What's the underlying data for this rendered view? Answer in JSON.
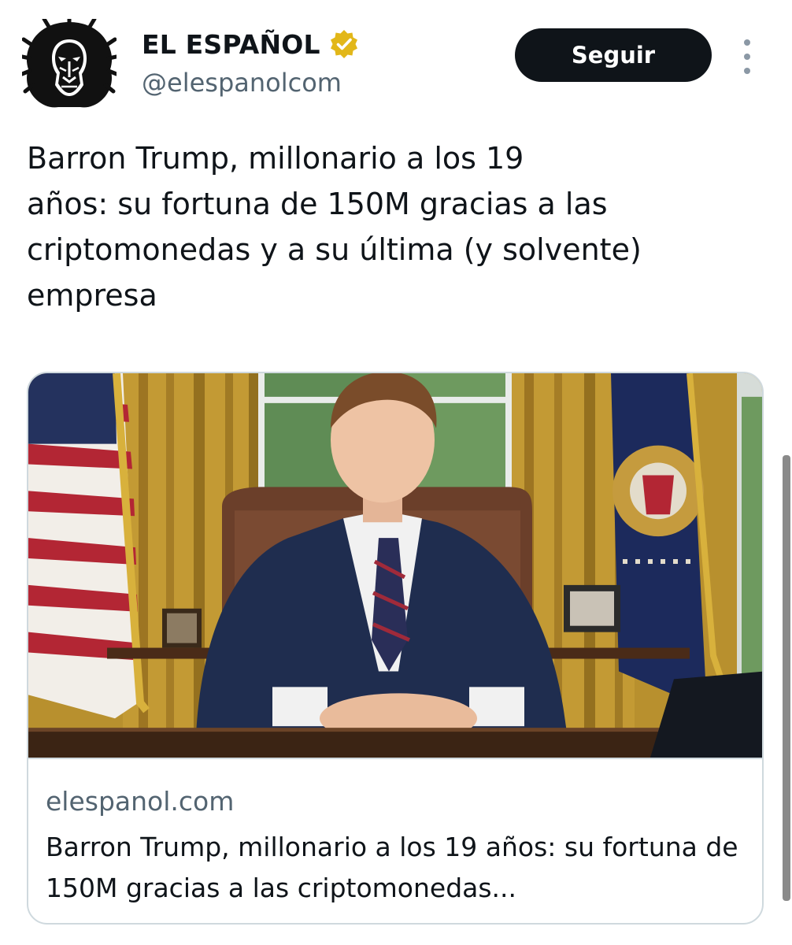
{
  "account": {
    "display_name": "EL ESPAÑOL",
    "handle": "@elespanolcom",
    "avatar_icon": "lion-head-logo",
    "verified_icon": "verified-gold-badge-icon",
    "verified_color": "#e2b719"
  },
  "actions": {
    "follow_label": "Seguir",
    "more_icon": "more-vertical-icon"
  },
  "tweet": {
    "text": "Barron Trump, millonario a los 19\naños: su fortuna de 150M gracias a las\ncriptomonedas y a su última (y solvente)\nempresa"
  },
  "link_card": {
    "domain": "elespanol.com",
    "title": "Barron Trump, millonario a los 19 años: su fortuna de 150M gracias a las criptomonedas..."
  },
  "colors": {
    "text_primary": "#0f1419",
    "text_secondary": "#536471",
    "button_bg": "#0f1419",
    "card_border": "#cfd9de"
  }
}
